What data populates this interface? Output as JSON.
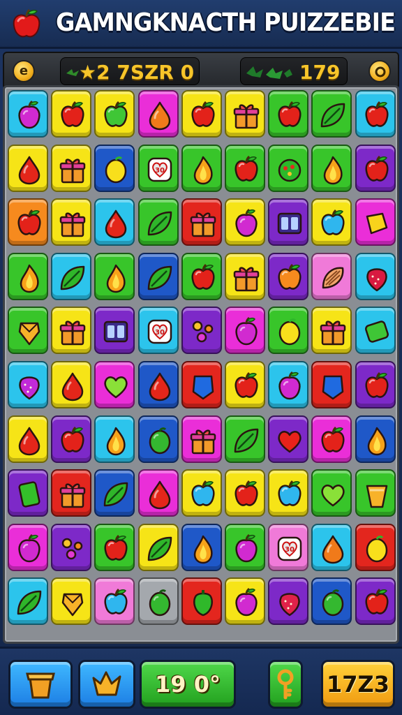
{
  "header": {
    "title": "GAMNGKNACTH PUIZZEBIE",
    "logo_icon": "apple-icon"
  },
  "scorebar": {
    "left_badge_icon": "coin-icon",
    "left_badge_glyph": "e",
    "left_score": "★2 7SZR 0",
    "right_score": "179",
    "right_badge_icon": "coin-icon"
  },
  "colors": {
    "cyan": "#2cc4ec",
    "yellow": "#f6e417",
    "green": "#38c52a",
    "magenta": "#ea2ed8",
    "blue": "#1f58c8",
    "orange": "#f68a1e",
    "red": "#e3261e",
    "purple": "#7d29c8",
    "pink": "#f07ad8",
    "gray": "#a4a8ad"
  },
  "board": {
    "rows": 10,
    "cols": 9,
    "tiles": [
      [
        [
          "cyan",
          "plum"
        ],
        [
          "yellow",
          "apple"
        ],
        [
          "yellow",
          "green-apple"
        ],
        [
          "magenta",
          "orange-drop"
        ],
        [
          "yellow",
          "apple"
        ],
        [
          "yellow",
          "gift"
        ],
        [
          "green",
          "apple"
        ],
        [
          "green",
          "leaf"
        ],
        [
          "cyan",
          "apple"
        ]
      ],
      [
        [
          "yellow",
          "drop"
        ],
        [
          "yellow",
          "gift"
        ],
        [
          "blue",
          "lemon"
        ],
        [
          "green",
          "heart-card"
        ],
        [
          "green",
          "flame"
        ],
        [
          "green",
          "apple"
        ],
        [
          "green",
          "ornament"
        ],
        [
          "green",
          "flame"
        ],
        [
          "purple",
          "apple"
        ]
      ],
      [
        [
          "orange",
          "apple"
        ],
        [
          "yellow",
          "gift"
        ],
        [
          "cyan",
          "drop"
        ],
        [
          "green",
          "leaf"
        ],
        [
          "red",
          "gift"
        ],
        [
          "yellow",
          "plum"
        ],
        [
          "purple",
          "card"
        ],
        [
          "yellow",
          "apple-blue"
        ],
        [
          "magenta",
          "lemon-square"
        ]
      ],
      [
        [
          "green",
          "flame"
        ],
        [
          "cyan",
          "leaf"
        ],
        [
          "green",
          "flame"
        ],
        [
          "blue",
          "leaf"
        ],
        [
          "green",
          "apple"
        ],
        [
          "yellow",
          "gift"
        ],
        [
          "purple",
          "orange-apple"
        ],
        [
          "pink",
          "shell"
        ],
        [
          "cyan",
          "strawberry"
        ]
      ],
      [
        [
          "green",
          "gem"
        ],
        [
          "yellow",
          "gift"
        ],
        [
          "purple",
          "card"
        ],
        [
          "cyan",
          "heart-card"
        ],
        [
          "purple",
          "flower"
        ],
        [
          "magenta",
          "plum"
        ],
        [
          "green",
          "lemon"
        ],
        [
          "yellow",
          "gift"
        ],
        [
          "cyan",
          "leaf-square"
        ]
      ],
      [
        [
          "cyan",
          "berry"
        ],
        [
          "yellow",
          "drop"
        ],
        [
          "magenta",
          "green-heart"
        ],
        [
          "blue",
          "drop"
        ],
        [
          "red",
          "shield"
        ],
        [
          "yellow",
          "apple"
        ],
        [
          "cyan",
          "plum"
        ],
        [
          "red",
          "shield"
        ],
        [
          "purple",
          "apple"
        ]
      ],
      [
        [
          "yellow",
          "drop"
        ],
        [
          "purple",
          "apple"
        ],
        [
          "cyan",
          "flame"
        ],
        [
          "blue",
          "lime"
        ],
        [
          "magenta",
          "gift"
        ],
        [
          "green",
          "leaf"
        ],
        [
          "purple",
          "heart"
        ],
        [
          "magenta",
          "apple"
        ],
        [
          "blue",
          "flame"
        ]
      ],
      [
        [
          "purple",
          "block"
        ],
        [
          "red",
          "gift"
        ],
        [
          "blue",
          "leaf"
        ],
        [
          "magenta",
          "drop"
        ],
        [
          "yellow",
          "apple-blue"
        ],
        [
          "yellow",
          "apple"
        ],
        [
          "yellow",
          "apple-blue"
        ],
        [
          "green",
          "green-heart"
        ],
        [
          "green",
          "cup"
        ]
      ],
      [
        [
          "magenta",
          "plum"
        ],
        [
          "purple",
          "flower"
        ],
        [
          "green",
          "apple"
        ],
        [
          "yellow",
          "leaf"
        ],
        [
          "blue",
          "flame"
        ],
        [
          "green",
          "plum"
        ],
        [
          "pink",
          "heart-card"
        ],
        [
          "cyan",
          "orange-drop"
        ],
        [
          "red",
          "lemon"
        ]
      ],
      [
        [
          "cyan",
          "leaf"
        ],
        [
          "yellow",
          "gem"
        ],
        [
          "pink",
          "apple-blue"
        ],
        [
          "gray",
          "lime"
        ],
        [
          "red",
          "pepper"
        ],
        [
          "yellow",
          "plum"
        ],
        [
          "purple",
          "berry-red"
        ],
        [
          "blue",
          "lime"
        ],
        [
          "purple",
          "apple"
        ]
      ]
    ]
  },
  "toolbar": {
    "buttons": [
      {
        "name": "crate-button",
        "icon": "crate-icon"
      },
      {
        "name": "crown-button",
        "icon": "crown-icon"
      },
      {
        "name": "score-button",
        "label": "19 0°"
      },
      {
        "name": "key-button",
        "icon": "key-icon"
      },
      {
        "name": "moves-button",
        "label": "17Z3"
      }
    ]
  }
}
